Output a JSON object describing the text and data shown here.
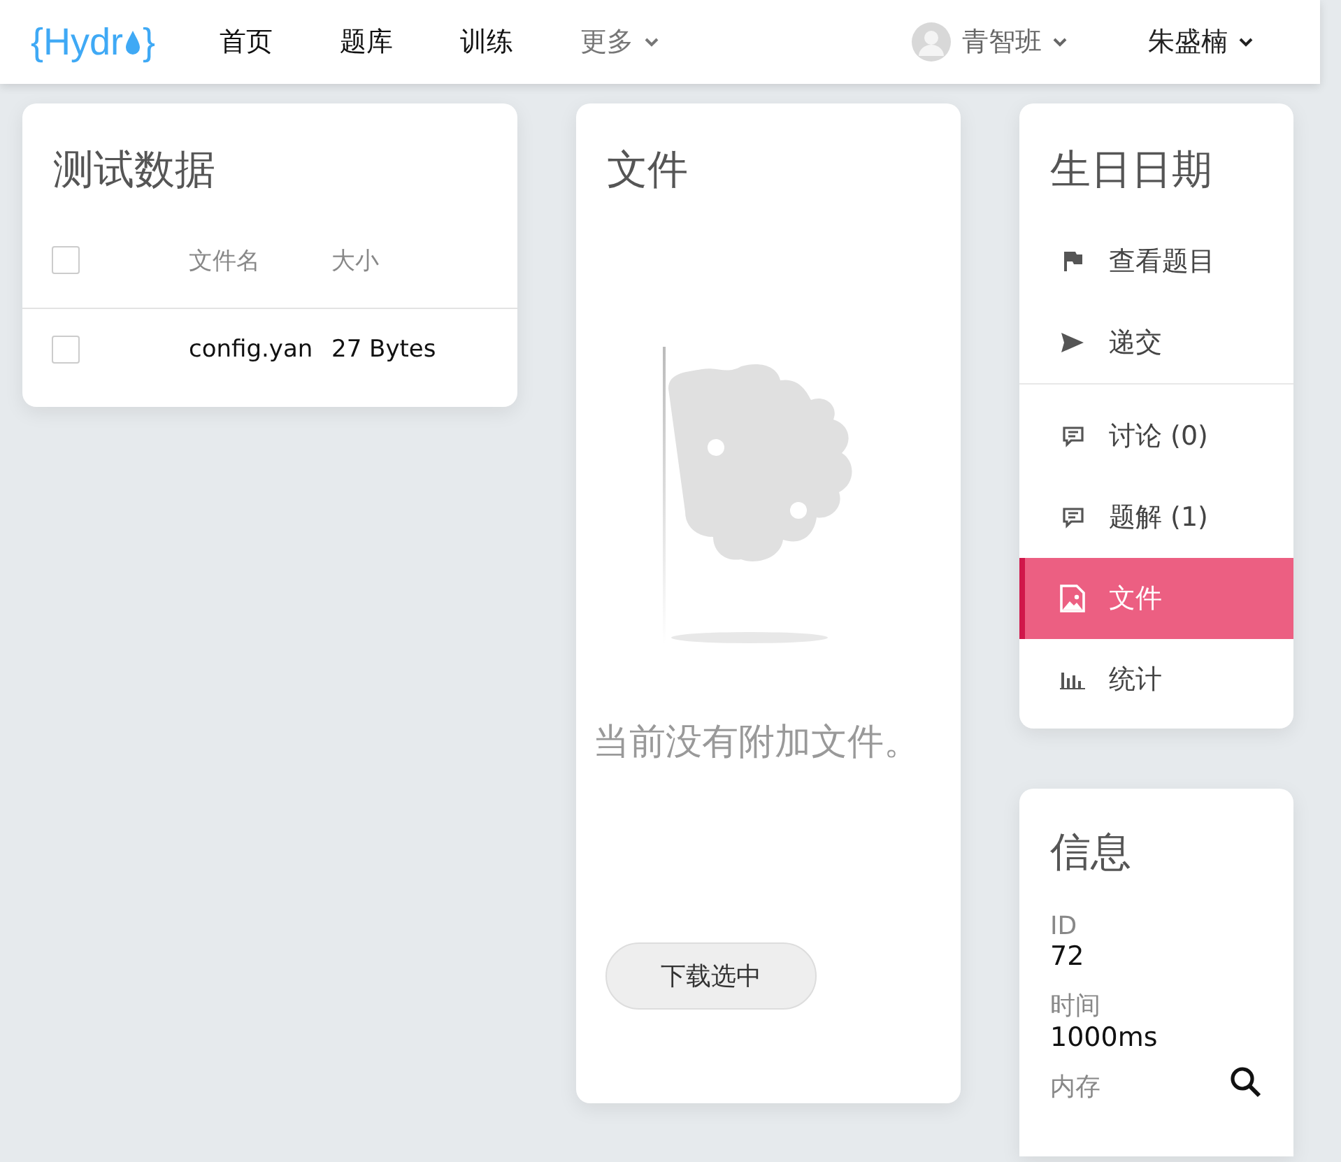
{
  "header": {
    "logo": {
      "left": "{",
      "name": "Hydr",
      "right": "}"
    },
    "nav": [
      {
        "label": "首页",
        "dropdown": false
      },
      {
        "label": "题库",
        "dropdown": false
      },
      {
        "label": "训练",
        "dropdown": false
      },
      {
        "label": "更多",
        "dropdown": true
      }
    ],
    "user_menus": [
      {
        "label": "青智班",
        "avatar": true
      },
      {
        "label": "朱盛楠",
        "avatar": false
      }
    ]
  },
  "testdata": {
    "title": "测试数据",
    "columns": [
      "文件名",
      "大小"
    ],
    "header_checked": false,
    "rows": [
      {
        "checked": false,
        "name": "config.yan",
        "size": "27 Bytes"
      }
    ]
  },
  "files": {
    "title": "文件",
    "empty_message": "当前没有附加文件。",
    "button": "下载选中"
  },
  "problem_menu": {
    "title": "生日日期",
    "groups": [
      [
        {
          "kind": "flag",
          "label": "查看题目",
          "selected": false
        },
        {
          "kind": "send",
          "label": "递交",
          "selected": false
        }
      ],
      [
        {
          "kind": "comment",
          "label": "讨论 (0)",
          "selected": false
        },
        {
          "kind": "comment",
          "label": "题解 (1)",
          "selected": false
        },
        {
          "kind": "image",
          "label": "文件",
          "selected": true
        },
        {
          "kind": "chart",
          "label": "统计",
          "selected": false
        }
      ]
    ]
  },
  "info": {
    "title": "信息",
    "fields": [
      {
        "label": "ID",
        "value": "72"
      },
      {
        "label": "时间",
        "value": "1000ms"
      },
      {
        "label": "内存"
      }
    ]
  }
}
